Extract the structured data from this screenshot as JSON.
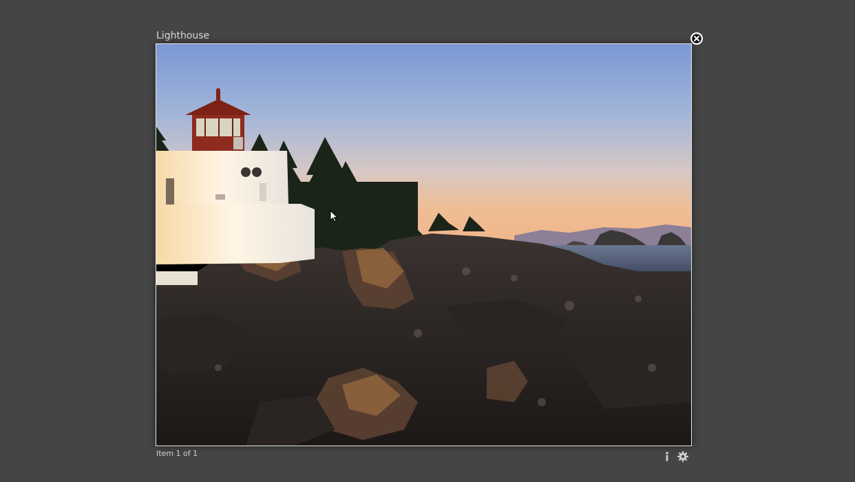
{
  "viewer": {
    "title": "Lighthouse",
    "counter": "Item 1 of 1"
  },
  "photo": {
    "subject": "lighthouse-on-rocky-shore"
  },
  "icons": {
    "close": "close-circle-icon",
    "info": "info-icon",
    "settings": "gear-icon"
  },
  "colors": {
    "background": "#454545",
    "text": "#d8d8d8"
  }
}
